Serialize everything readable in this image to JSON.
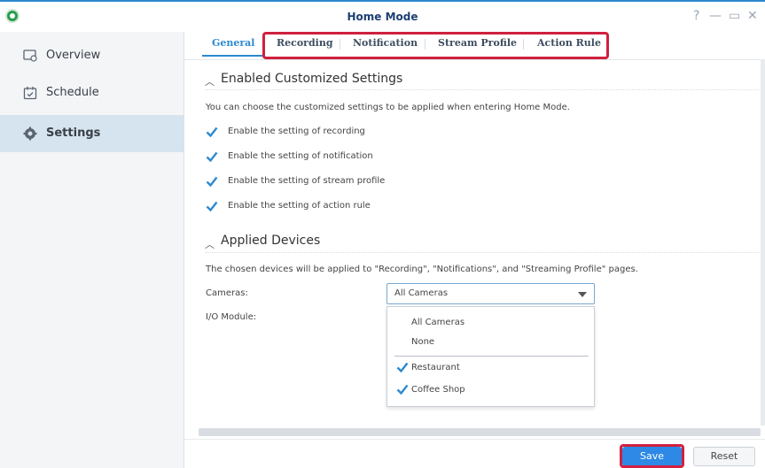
{
  "window": {
    "title": "Home Mode",
    "controls": {
      "help": "?",
      "minimize": "—",
      "maximize": "▭",
      "close": "✕"
    }
  },
  "sidebar": {
    "items": [
      {
        "label": "Overview",
        "icon": "monitor-icon",
        "active": false
      },
      {
        "label": "Schedule",
        "icon": "calendar-icon",
        "active": false
      },
      {
        "label": "Settings",
        "icon": "gear-icon",
        "active": true
      }
    ]
  },
  "tabs": [
    {
      "label": "General",
      "active": true
    },
    {
      "label": "Recording",
      "active": false
    },
    {
      "label": "Notification",
      "active": false
    },
    {
      "label": "Stream Profile",
      "active": false
    },
    {
      "label": "Action Rule",
      "active": false
    }
  ],
  "section1": {
    "title": "Enabled Customized Settings",
    "description": "You can choose the customized settings to be applied when entering Home Mode.",
    "options": [
      {
        "label": "Enable the setting of recording",
        "checked": true
      },
      {
        "label": "Enable the setting of notification",
        "checked": true
      },
      {
        "label": "Enable the setting of stream profile",
        "checked": true
      },
      {
        "label": "Enable the setting of action rule",
        "checked": true
      }
    ]
  },
  "section2": {
    "title": "Applied Devices",
    "description": "The chosen devices will be applied to \"Recording\", \"Notifications\", and \"Streaming Profile\" pages.",
    "cameras_label": "Cameras:",
    "cameras_value": "All Cameras",
    "io_label": "I/O Module:",
    "dropdown_options": [
      {
        "label": "All Cameras",
        "checked": null
      },
      {
        "label": "None",
        "checked": null
      },
      {
        "label": "Restaurant",
        "checked": true
      },
      {
        "label": "Coffee Shop",
        "checked": true
      }
    ]
  },
  "buttons": {
    "save": "Save",
    "reset": "Reset"
  },
  "colors": {
    "accent": "#2d89d0",
    "highlight": "#d0203f",
    "sidebar_active": "#d6e4ef"
  }
}
